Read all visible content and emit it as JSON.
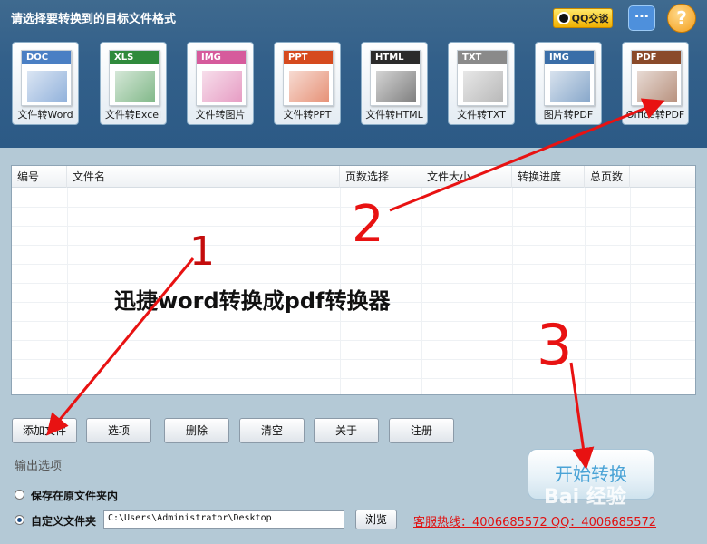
{
  "header": {
    "title": "请选择要转换到的目标文件格式",
    "qq_label": "QQ交谈"
  },
  "formats": [
    {
      "tag": "DOC",
      "label": "文件转Word",
      "color": "#4a7fc4"
    },
    {
      "tag": "XLS",
      "label": "文件转Excel",
      "color": "#2f8a3c"
    },
    {
      "tag": "IMG",
      "label": "文件转图片",
      "color": "#d65b9c"
    },
    {
      "tag": "PPT",
      "label": "文件转PPT",
      "color": "#d64a1e"
    },
    {
      "tag": "HTML",
      "label": "文件转HTML",
      "color": "#2b2b2b"
    },
    {
      "tag": "TXT",
      "label": "文件转TXT",
      "color": "#8a8a8a"
    },
    {
      "tag": "IMG",
      "label": "图片转PDF",
      "color": "#3a6ea8"
    },
    {
      "tag": "PDF",
      "label": "Office转PDF",
      "color": "#8a4a2a"
    }
  ],
  "table": {
    "columns": [
      "编号",
      "文件名",
      "页数选择",
      "文件大小",
      "转换进度",
      "总页数"
    ]
  },
  "actions": [
    "添加文件",
    "选项",
    "删除",
    "清空",
    "关于",
    "注册"
  ],
  "output": {
    "section_label": "输出选项",
    "option_original": "保存在原文件夹内",
    "option_custom": "自定义文件夹",
    "path_value": "C:\\Users\\Administrator\\Desktop",
    "browse_label": "浏览",
    "hotline": "客服热线：4006685572 QQ：4006685572"
  },
  "start_label": "开始转换",
  "annotation": {
    "caption": "迅捷word转换成pdf转换器",
    "marks": [
      "1",
      "2",
      "3"
    ]
  },
  "watermark": "Bai 经验",
  "colors": {
    "arrow": "#e81212",
    "topbar": "#33608a",
    "hotline": "#e01010"
  }
}
